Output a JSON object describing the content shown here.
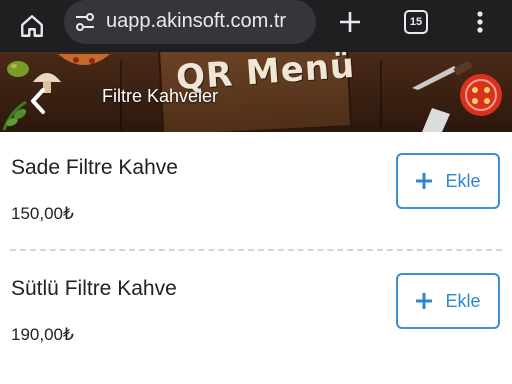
{
  "browser": {
    "url": "uapp.akinsoft.com.tr",
    "tab_count": "15"
  },
  "header": {
    "logo_text": "QR Menü",
    "title": "Filtre Kahveler"
  },
  "products": [
    {
      "name": "Sade Filtre Kahve",
      "price": "150,00₺",
      "add_label": "Ekle"
    },
    {
      "name": "Sütlü Filtre Kahve",
      "price": "190,00₺",
      "add_label": "Ekle"
    }
  ],
  "colors": {
    "accent": "#2f86d2",
    "browser_bar": "#1f1f22",
    "url_pill": "#35363a"
  }
}
